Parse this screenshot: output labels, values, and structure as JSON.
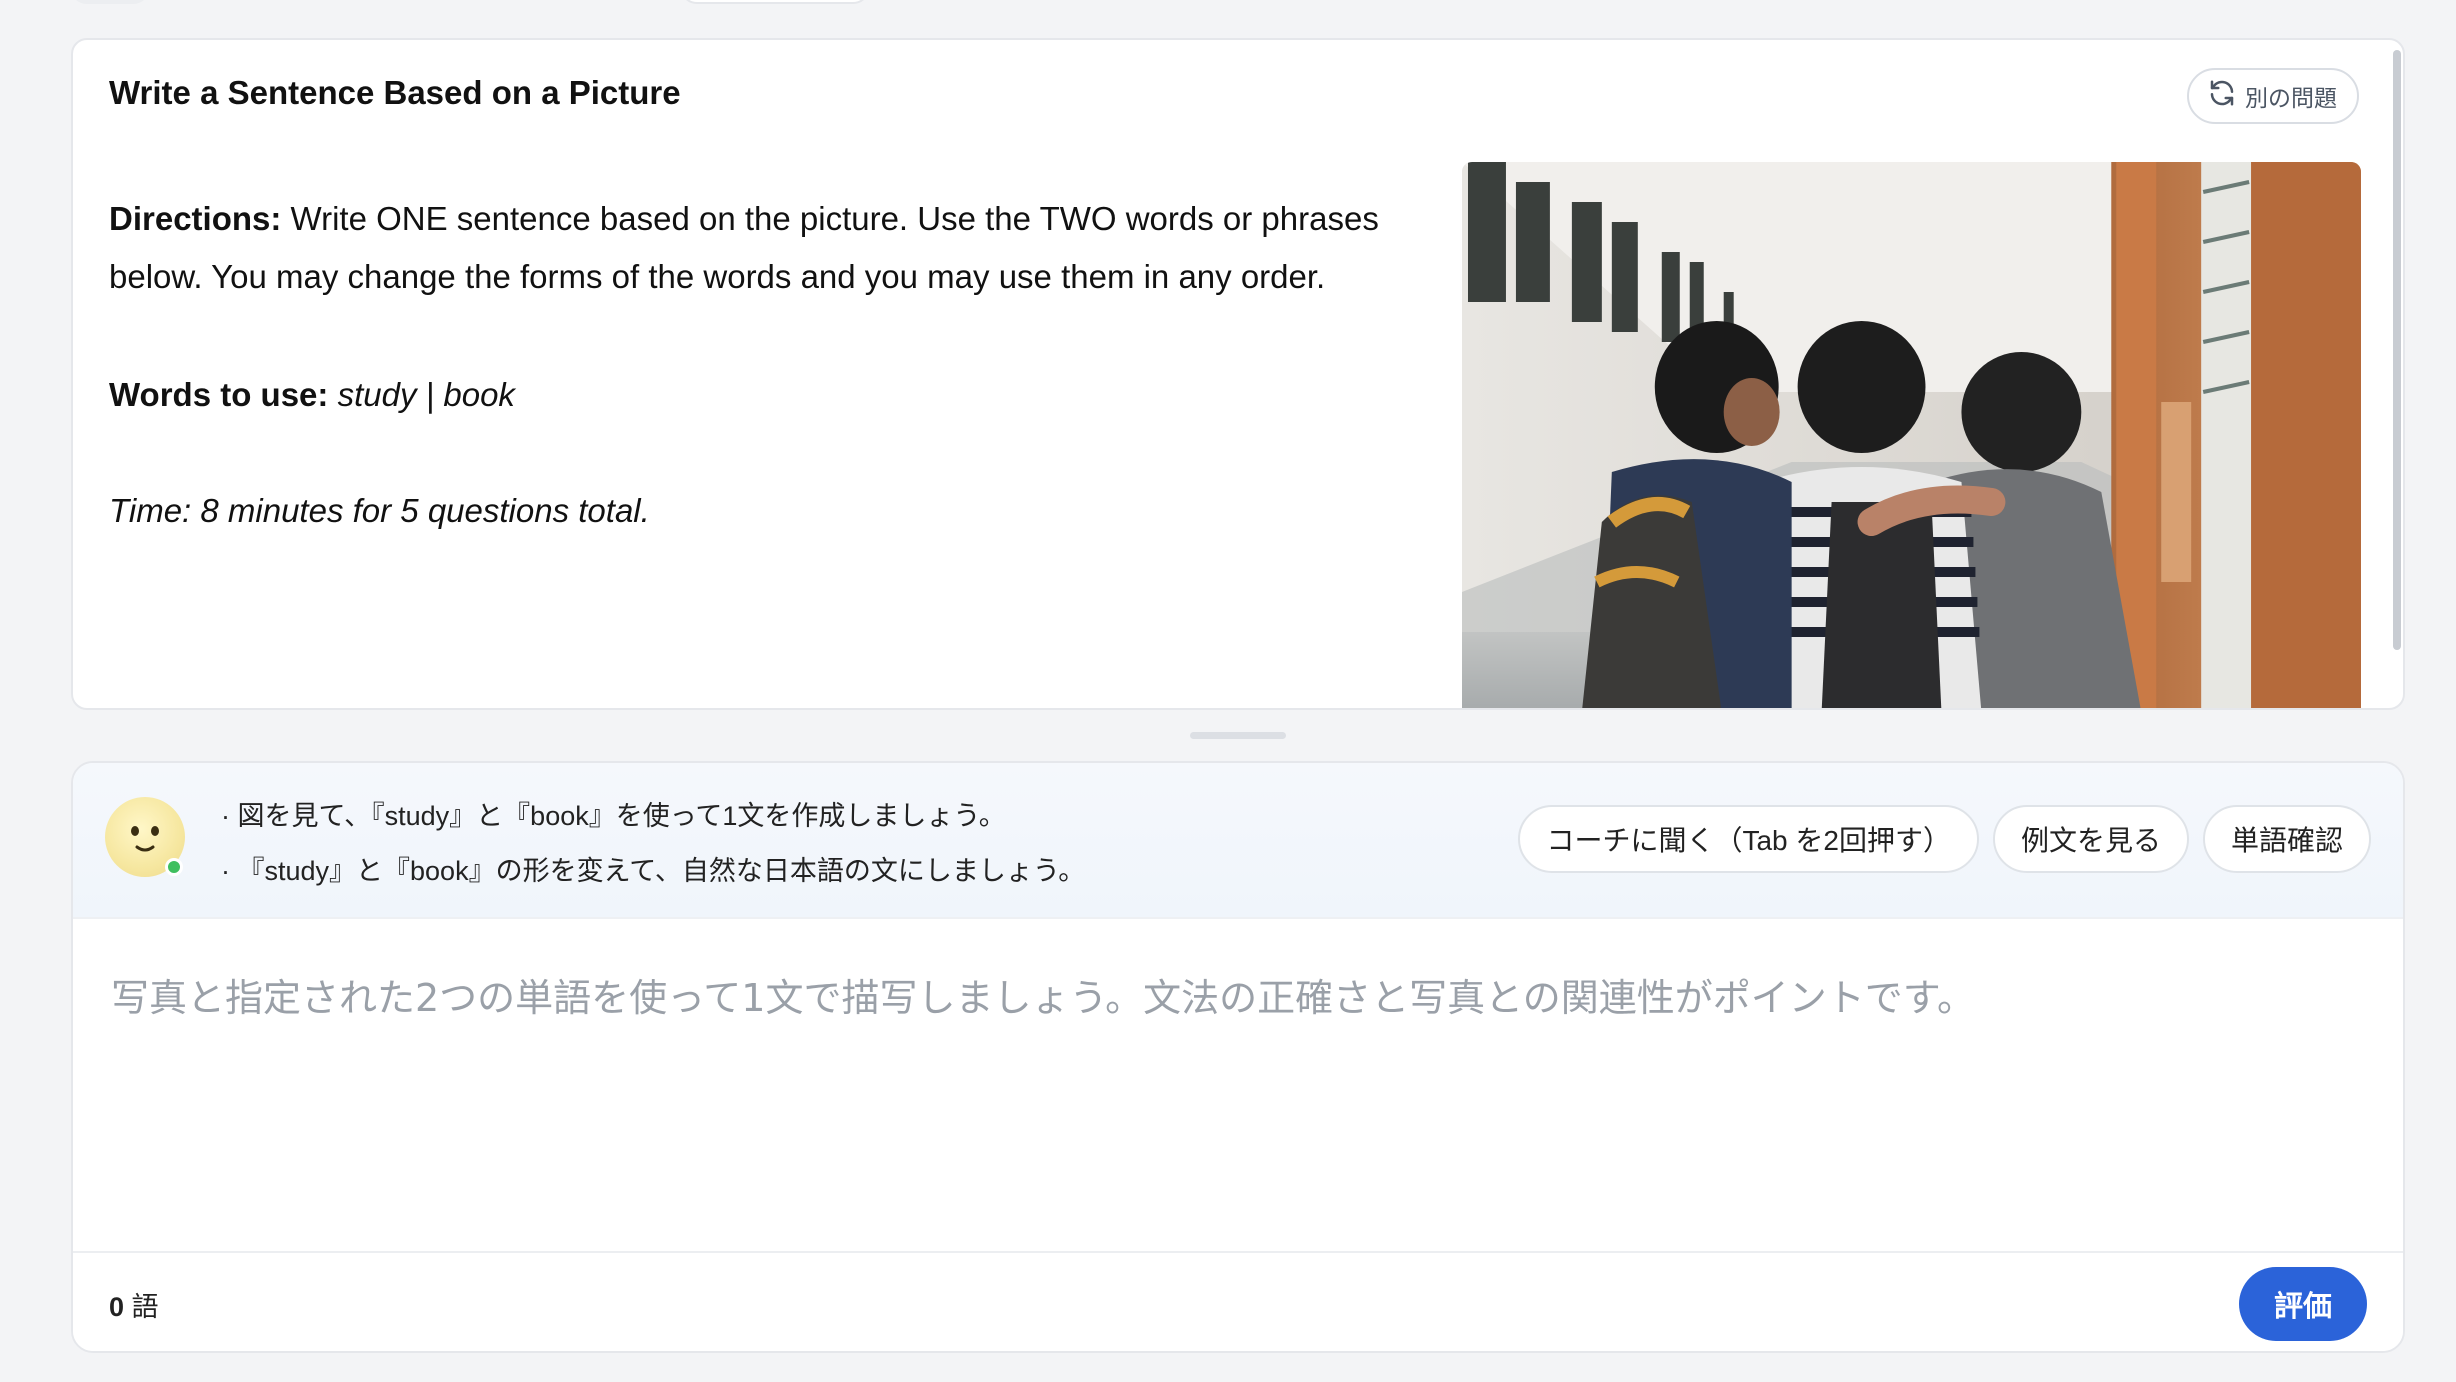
{
  "question": {
    "title": "Write a Sentence Based on a Picture",
    "refresh_label": "別の問題",
    "directions_label": "Directions:",
    "directions_text": " Write ONE sentence based on the picture. Use the TWO words or phrases below. You may change the forms of the words and you may use them in any order.",
    "words_label": "Words to use:",
    "words_value": " study | book",
    "time_note": "Time: 8 minutes for 5 questions total."
  },
  "coach": {
    "tips": [
      "· 図を見て、『study』と『book』を使って1文を作成しましょう。",
      "· 『study』と『book』の形を変えて、自然な日本語の文にしましょう。"
    ],
    "buttons": {
      "ask_coach": "コーチに聞く（Tab を2回押す）",
      "example": "例文を見る",
      "vocab": "単語確認"
    }
  },
  "answer": {
    "placeholder": "写真と指定された2つの単語を使って1文で描写しましょう。文法の正確さと写真との関連性がポイントです。",
    "value": ""
  },
  "footer": {
    "word_count": "0",
    "word_unit": "語",
    "evaluate_label": "評価"
  },
  "colors": {
    "accent": "#2b63d9",
    "online": "#3fbf5f"
  }
}
